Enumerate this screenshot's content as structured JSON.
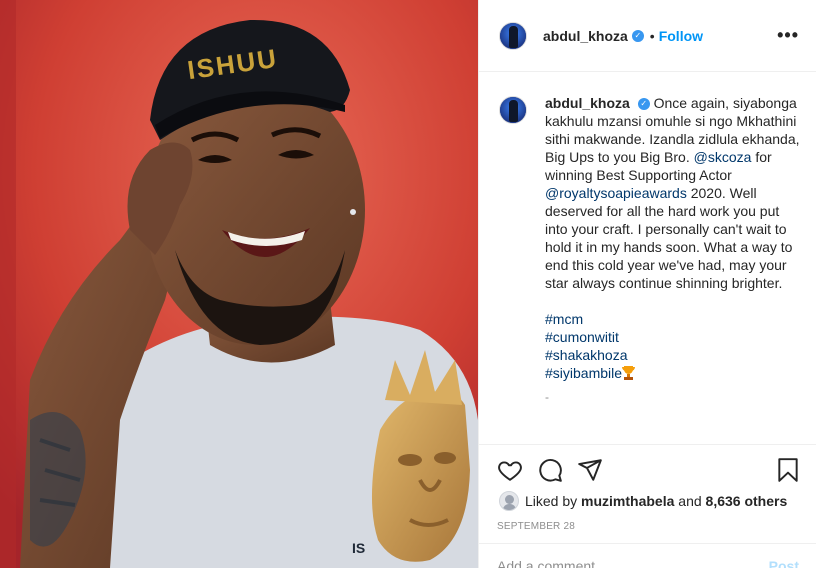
{
  "post": {
    "username": "abdul_khoza",
    "follow_label": "Follow",
    "dot": "•",
    "more_label": "•••",
    "cap_text": "ISHUU",
    "shirt_text": "IS"
  },
  "caption": {
    "username": "abdul_khoza",
    "text_1": "Once again, siyabonga kakhulu mzansi omuhle si ngo Mkhathini sithi makwande. Izandla zidlula ekhanda, Big Ups to you Big Bro.",
    "mention_1": "@skcoza",
    "text_2": "for winning Best Supporting Actor",
    "mention_2": "@royaltysoapieawards",
    "text_3": "2020. Well deserved for all the hard work you put into your craft. I personally can't wait to hold it in my hands soon. What a way to end this cold year we've had, may your star always continue shinning brighter.",
    "hashtags": [
      "#mcm",
      "#cumonwitit",
      "#shakakhoza",
      "#siyibambile"
    ],
    "truncated_marker": "-"
  },
  "likes": {
    "prefix": "Liked by",
    "user": "muzimthabela",
    "and": "and",
    "count": "8,636 others"
  },
  "date": "SEPTEMBER 28",
  "add_comment": {
    "placeholder": "Add a comment...",
    "post_label": "Post"
  },
  "icons": {
    "like": "heart-icon",
    "comment": "comment-icon",
    "share": "share-icon",
    "save": "bookmark-icon",
    "verified": "verified-icon",
    "trophy": "trophy-emoji"
  },
  "colors": {
    "link": "#00376b",
    "follow": "#0095f6",
    "verified": "#3897f0",
    "muted": "#8e8e8e",
    "photo_background": "#d24a3a"
  }
}
